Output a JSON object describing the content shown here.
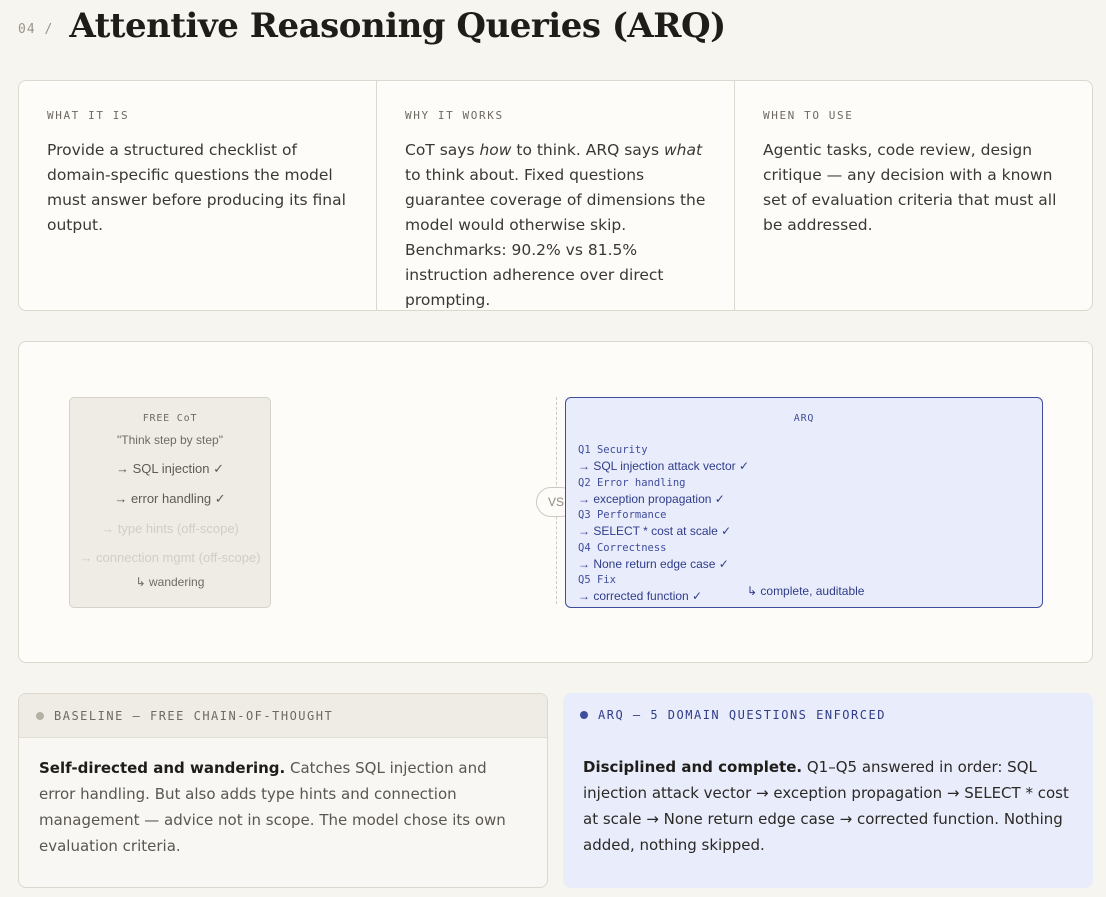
{
  "header": {
    "section_number": "04 /",
    "title": "Attentive Reasoning Queries (ARQ)"
  },
  "info": [
    {
      "label": "WHAT IT IS",
      "text": "Provide a structured checklist of domain-specific questions the model must answer before producing its final output."
    },
    {
      "label": "WHY IT WORKS",
      "text_parts": [
        "CoT says ",
        "how",
        " to think. ARQ says ",
        "what",
        " to think about. Fixed questions guarantee coverage of dimensions the model would otherwise skip. Benchmarks: 90.2% vs 81.5% instruction adherence over direct prompting."
      ]
    },
    {
      "label": "WHEN TO USE",
      "text": "Agentic tasks, code review, design critique — any decision with a known set of evaluation criteria that must all be addressed."
    }
  ],
  "diagram": {
    "cot": {
      "title": "FREE CoT",
      "quote": "\"Think step by step\"",
      "lines": [
        "→ SQL injection ✓",
        "→ error handling ✓",
        "→ type hints (off-scope)",
        "→ connection mgmt (off-scope)"
      ],
      "footer": "↳ wandering"
    },
    "vs_label": "VS",
    "arq": {
      "title": "ARQ",
      "items": [
        {
          "q": "Q1 Security",
          "a": "→ SQL injection attack vector ✓"
        },
        {
          "q": "Q2 Error handling",
          "a": "→ exception propagation ✓"
        },
        {
          "q": "Q3 Performance",
          "a": "→ SELECT * cost at scale ✓"
        },
        {
          "q": "Q4 Correctness",
          "a": "→ None return edge case ✓"
        },
        {
          "q": "Q5 Fix",
          "a": "→ corrected function ✓"
        }
      ],
      "footer": "↳ complete, auditable"
    }
  },
  "baseline_card": {
    "label": "BASELINE — FREE CHAIN-OF-THOUGHT",
    "lead": "Self-directed and wandering.",
    "text": " Catches SQL injection and error handling. But also adds type hints and connection management — advice not in scope. The model chose its own evaluation criteria."
  },
  "arq_card": {
    "label": "ARQ — 5 DOMAIN QUESTIONS ENFORCED",
    "lead": "Disciplined and complete.",
    "text": " Q1–Q5 answered in order: SQL injection attack vector → exception propagation → SELECT * cost at scale → None return edge case → corrected function. Nothing added, nothing skipped."
  },
  "colors": {
    "background": "#f7f5f0",
    "arq_accent": "#3f4d9c",
    "arq_fill": "#e9edfb",
    "cot_fill": "#efece6"
  }
}
